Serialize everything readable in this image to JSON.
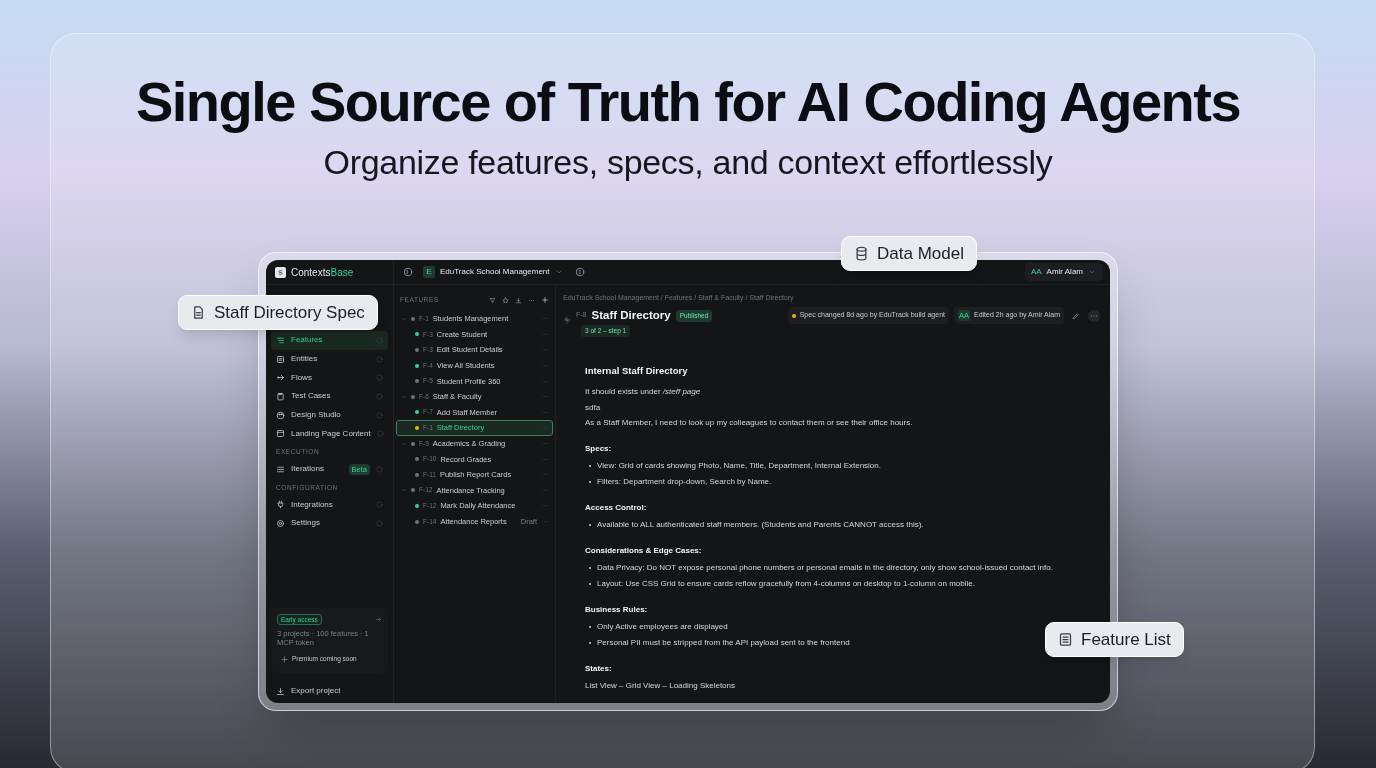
{
  "hero": {
    "title": "Single Source of Truth for AI Coding Agents",
    "subtitle": "Organize features, specs, and context effortlessly"
  },
  "callouts": [
    {
      "kind": "spec",
      "label": "Staff Directory Spec"
    },
    {
      "kind": "database",
      "label": "Data Model"
    },
    {
      "kind": "list",
      "label": "Feature List"
    }
  ],
  "app": {
    "brand_main": "Contexts",
    "brand_accent": "Base",
    "project": {
      "badge": "E",
      "name": "EduTrack School Management"
    },
    "user": {
      "initials": "AA",
      "name": "Amir Alam"
    },
    "sidebar": {
      "sections": [
        {
          "items": [
            {
              "kind": "features",
              "label": "Features",
              "selected": true
            },
            {
              "kind": "entities",
              "label": "Entities",
              "selected": false
            },
            {
              "kind": "flows",
              "label": "Flows",
              "selected": false
            },
            {
              "kind": "tests",
              "label": "Test Cases",
              "selected": false
            },
            {
              "kind": "design",
              "label": "Design Studio",
              "selected": false
            },
            {
              "kind": "landing",
              "label": "Landing Page Content",
              "selected": false
            }
          ]
        },
        {
          "heading": "EXECUTION",
          "items": [
            {
              "kind": "iterations",
              "label": "Iterations",
              "badge": "Beta",
              "selected": false
            }
          ]
        },
        {
          "heading": "CONFIGURATION",
          "items": [
            {
              "kind": "integrations",
              "label": "Integrations",
              "selected": false
            },
            {
              "kind": "settings",
              "label": "Settings",
              "selected": false
            }
          ]
        }
      ],
      "early_access": {
        "badge": "Early access",
        "text": "3 projects · 100 features · 1 MCP token",
        "premium": "Premium coming soon"
      },
      "export": "Export project"
    },
    "features": {
      "heading": "FEATURES",
      "items": [
        {
          "id": "F-1",
          "name": "Students Management",
          "color": "#6b7280",
          "expanded": true,
          "selected": false,
          "children": [
            {
              "id": "F-3",
              "name": "Create Student",
              "color": "#34d399",
              "selected": false
            },
            {
              "id": "F-3",
              "name": "Edit Student Details",
              "color": "#6b7280",
              "selected": false
            },
            {
              "id": "F-4",
              "name": "View All Students",
              "color": "#34d399",
              "selected": false
            },
            {
              "id": "F-5",
              "name": "Student Profile 360",
              "color": "#6b7280",
              "selected": false
            }
          ]
        },
        {
          "id": "F-6",
          "name": "Staff & Faculty",
          "color": "#6b7280",
          "expanded": true,
          "selected": false,
          "children": [
            {
              "id": "F-7",
              "name": "Add Staff Member",
              "color": "#34d399",
              "selected": false
            },
            {
              "id": "F-1",
              "name": "Staff Directory",
              "color": "#eab308",
              "selected": true
            }
          ]
        },
        {
          "id": "F-9",
          "name": "Academics & Grading",
          "color": "#6b7280",
          "expanded": true,
          "selected": false,
          "children": [
            {
              "id": "F-10",
              "name": "Record Grades",
              "color": "#6b7280",
              "selected": false
            },
            {
              "id": "F-11",
              "name": "Publish Report Cards",
              "color": "#6b7280",
              "selected": false
            }
          ]
        },
        {
          "id": "F-12",
          "name": "Attendance Tracking",
          "color": "#6b7280",
          "expanded": true,
          "selected": false,
          "children": [
            {
              "id": "F-12",
              "name": "Mark Daily Attendance",
              "color": "#34d399",
              "selected": false
            },
            {
              "id": "F-14",
              "name": "Attendance Reports",
              "color": "#6b7280",
              "badge": "Draft",
              "selected": false
            }
          ]
        }
      ]
    },
    "detail": {
      "breadcrumb": "EduTrack School Management / Features / Staff & Faculty / Staff Directory",
      "id": "F-8",
      "title": "Staff Directory",
      "status": "Published",
      "tag": "3 of 2 – step 1",
      "spec_change": {
        "color": "#eab308",
        "text": "Spec changed 8d ago by EduTrack build agent"
      },
      "edited": {
        "initials": "AA",
        "text": "Edited 2h ago by Amir Alam"
      },
      "doc": [
        {
          "kind": "title",
          "text": "Internal Staff Directory"
        },
        {
          "kind": "para",
          "text": "It should exists under */steff page*"
        },
        {
          "kind": "para",
          "text": "sdfa"
        },
        {
          "kind": "para",
          "text": "As a Staff Member, I need to look up my colleagues to contact them or see their office hours."
        },
        {
          "kind": "heading",
          "text": "Specs:"
        },
        {
          "kind": "bullet",
          "text": "View: Grid of cards showing Photo, Name, Title, Department, Internal Extension."
        },
        {
          "kind": "bullet",
          "text": "Filters: Department drop-down, Search by Name."
        },
        {
          "kind": "heading",
          "text": "Access Control:"
        },
        {
          "kind": "bullet",
          "text": "Available to ALL authenticated staff members. (Students and Parents CANNOT access this)."
        },
        {
          "kind": "heading",
          "text": "Considerations & Edge Cases:"
        },
        {
          "kind": "bullet",
          "text": "Data Privacy: Do NOT expose personal phone numbers or personal emails in the directory, only show school-issued contact info."
        },
        {
          "kind": "bullet",
          "text": "Layout: Use CSS Grid to ensure cards reflow gracefully from 4-columns on desktop to 1-column on mobile."
        },
        {
          "kind": "heading",
          "text": "Business Rules:"
        },
        {
          "kind": "bullet",
          "text": "Only Active employees are displayed"
        },
        {
          "kind": "bullet",
          "text": "Personal PII must be stripped from the API payload sent to the frontend"
        },
        {
          "kind": "heading",
          "text": "States:"
        },
        {
          "kind": "para",
          "text": "List View – Grid View – Loading Skeletons"
        }
      ]
    }
  }
}
